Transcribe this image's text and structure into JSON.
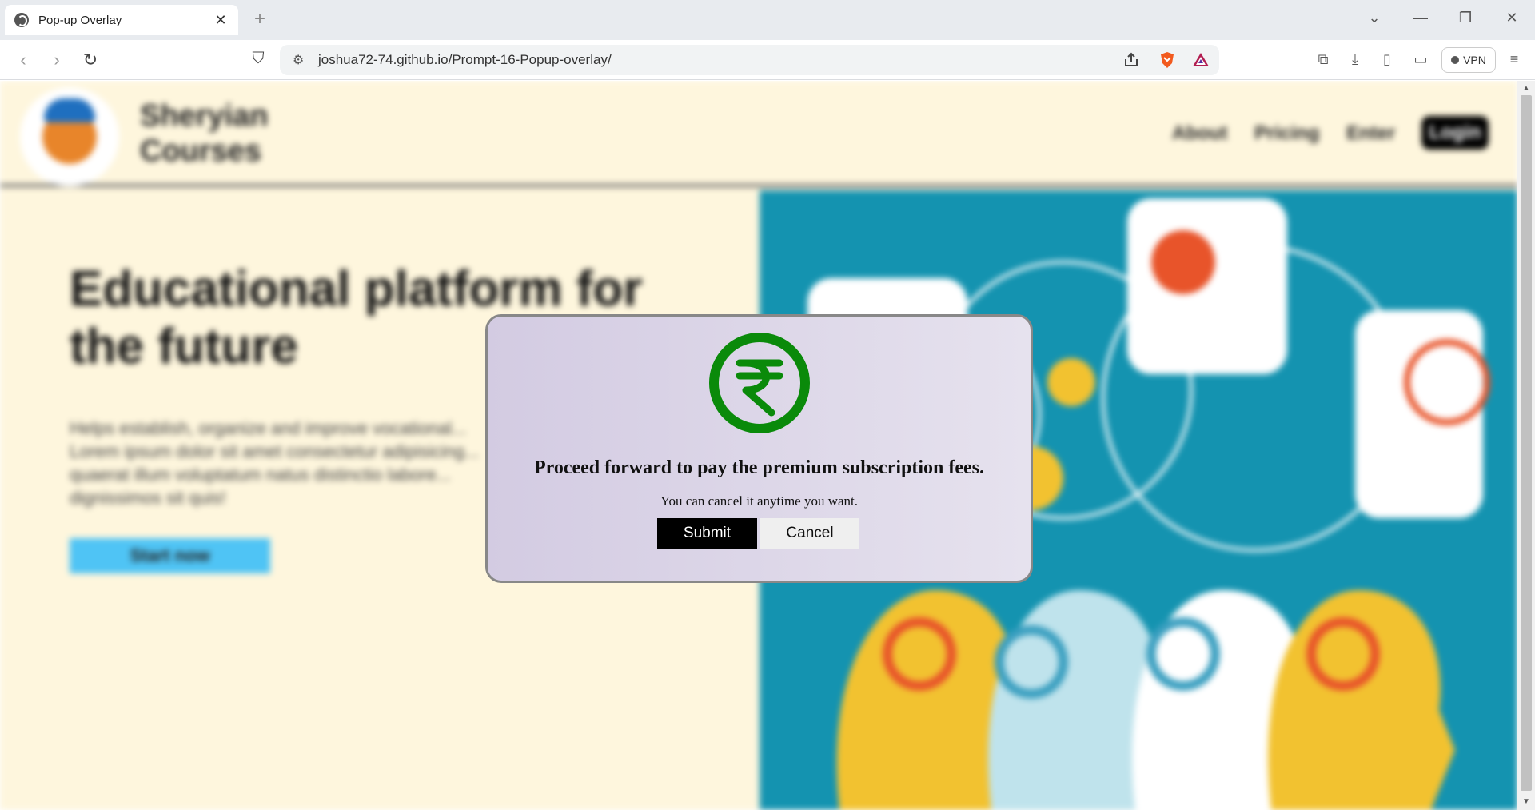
{
  "browser": {
    "tab_title": "Pop-up Overlay",
    "tab_close": "✕",
    "new_tab": "+",
    "url": "joshua72-74.github.io/Prompt-16-Popup-overlay/",
    "vpn_label": "VPN"
  },
  "site": {
    "brand_line1": "Sheryian",
    "brand_line2": "Courses",
    "nav": [
      "About",
      "Pricing",
      "Enter"
    ],
    "login": "Login",
    "hero_title": "Educational platform for the future",
    "hero_text": "Helps establish, organize and improve vocational... Lorem ipsum dolor sit amet consectetur adipisicing... quaerat illum voluptatum natus distinctio labore... dignissimos sit quis!",
    "start_button": "Start now"
  },
  "modal": {
    "icon": "rupee-icon",
    "title": "Proceed forward to pay the premium subscription fees.",
    "subtitle": "You can cancel it anytime you want.",
    "submit": "Submit",
    "cancel": "Cancel",
    "accent_color": "#0a8a0a"
  }
}
